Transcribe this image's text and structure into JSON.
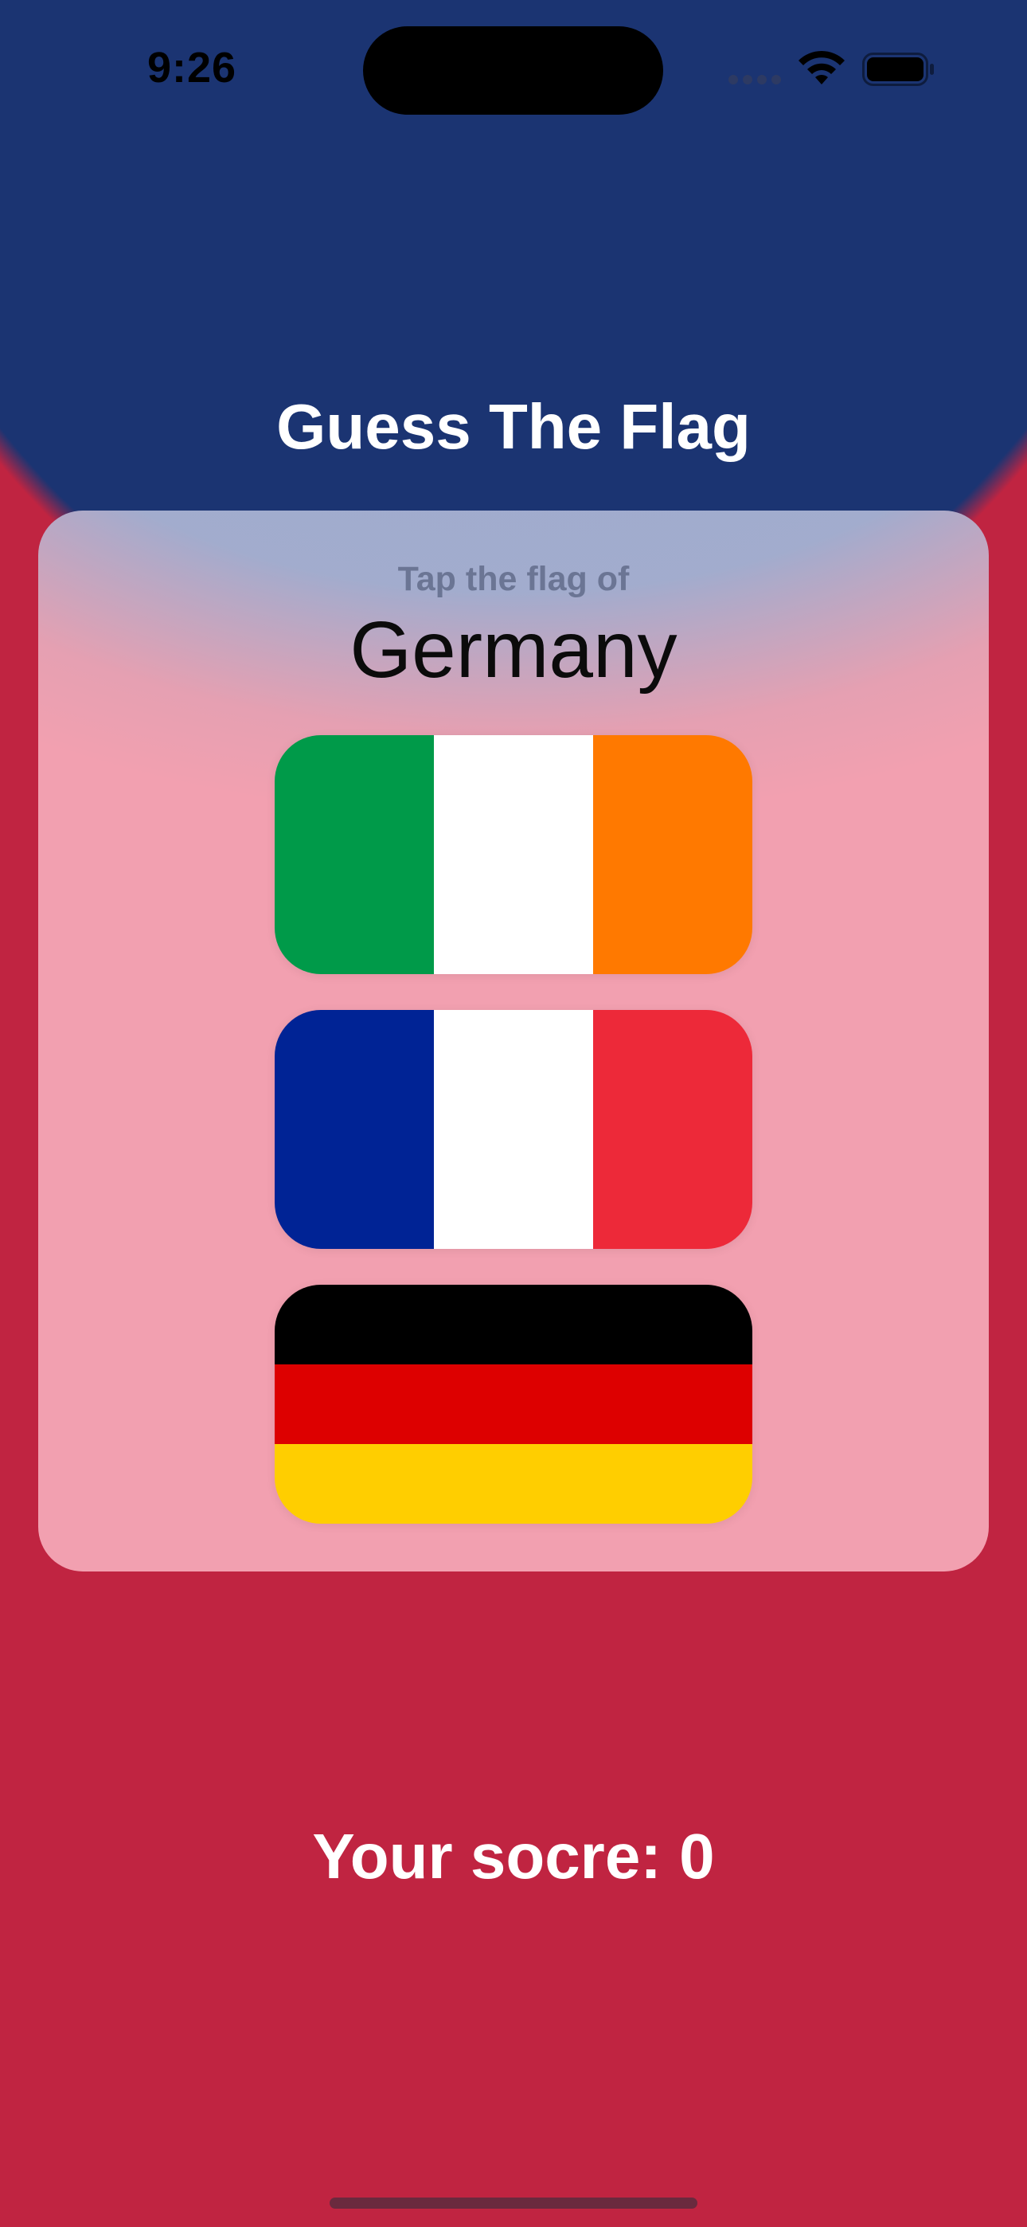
{
  "status_bar": {
    "time": "9:26"
  },
  "app": {
    "title": "Guess The Flag",
    "prompt_label": "Tap the flag of",
    "target_country": "Germany",
    "score_label": "Your socre: 0"
  },
  "flags": [
    {
      "icon": "ireland-flag",
      "orientation": "vertical",
      "colors": [
        "#009A49",
        "#FFFFFF",
        "#FF7900"
      ]
    },
    {
      "icon": "france-flag",
      "orientation": "vertical",
      "colors": [
        "#002395",
        "#FFFFFF",
        "#ED2939"
      ]
    },
    {
      "icon": "germany-flag",
      "orientation": "horizontal",
      "colors": [
        "#000000",
        "#DD0000",
        "#FFCE00"
      ]
    }
  ],
  "theme": {
    "top_color": "#1B3472",
    "bottom_color": "#C02441",
    "card_color": "#F2A0B0"
  }
}
